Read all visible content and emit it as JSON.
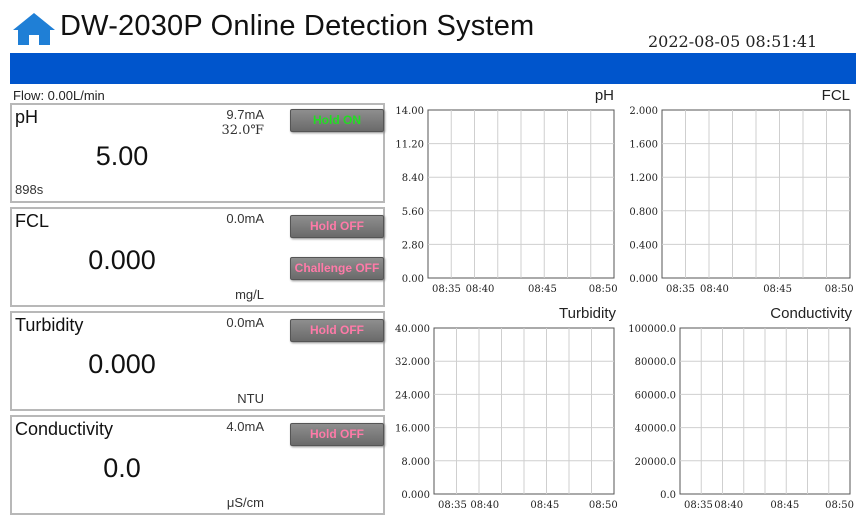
{
  "header": {
    "title": "DW-2030P Online Detection System",
    "datetime": "2022-08-05  08:51:41",
    "icon": "home-icon",
    "accent_color": "#0055cc"
  },
  "flow": {
    "label": "Flow: 0.00L/min"
  },
  "sensors": [
    {
      "name": "pH",
      "current": "9.7mA",
      "temperature": "32.0℉",
      "value": "5.00",
      "unit": "",
      "time": "898s",
      "buttons": [
        {
          "label": "Hold ON",
          "color": "#22dd22"
        }
      ]
    },
    {
      "name": "FCL",
      "current": "0.0mA",
      "temperature": "",
      "value": "0.000",
      "unit": "mg/L",
      "time": "",
      "buttons": [
        {
          "label": "Hold OFF",
          "color": "#ff7aa8"
        },
        {
          "label": "Challenge OFF",
          "color": "#ff7aa8"
        }
      ]
    },
    {
      "name": "Turbidity",
      "current": "0.0mA",
      "temperature": "",
      "value": "0.000",
      "unit": "NTU",
      "time": "",
      "buttons": [
        {
          "label": "Hold OFF",
          "color": "#ff7aa8"
        }
      ]
    },
    {
      "name": "Conductivity",
      "current": "4.0mA",
      "temperature": "",
      "value": "0.0",
      "unit": "μS/cm",
      "time": "",
      "buttons": [
        {
          "label": "Hold OFF",
          "color": "#ff7aa8"
        }
      ]
    }
  ],
  "chart_data": [
    {
      "type": "line",
      "title": "pH",
      "yticks": [
        "14.00",
        "11.20",
        "8.40",
        "5.60",
        "2.80",
        "0.00"
      ],
      "ylim": [
        0,
        14
      ],
      "xticks": [
        "08:35",
        "08:40",
        "08:45",
        "08:50"
      ],
      "grid": true,
      "series": []
    },
    {
      "type": "line",
      "title": "FCL",
      "yticks": [
        "2.000",
        "1.600",
        "1.200",
        "0.800",
        "0.400",
        "0.000"
      ],
      "ylim": [
        0,
        2
      ],
      "xticks": [
        "08:35",
        "08:40",
        "08:45",
        "08:50"
      ],
      "grid": true,
      "series": []
    },
    {
      "type": "line",
      "title": "Turbidity",
      "yticks": [
        "40.000",
        "32.000",
        "24.000",
        "16.000",
        "8.000",
        "0.000"
      ],
      "ylim": [
        0,
        40
      ],
      "xticks": [
        "08:35",
        "08:40",
        "08:45",
        "08:50"
      ],
      "grid": true,
      "series": []
    },
    {
      "type": "line",
      "title": "Conductivity",
      "yticks": [
        "100000.0",
        "80000.0",
        "60000.0",
        "40000.0",
        "20000.0",
        "0.0"
      ],
      "ylim": [
        0,
        100000
      ],
      "xticks": [
        "08:35",
        "08:40",
        "08:45",
        "08:50"
      ],
      "grid": true,
      "series": []
    }
  ]
}
